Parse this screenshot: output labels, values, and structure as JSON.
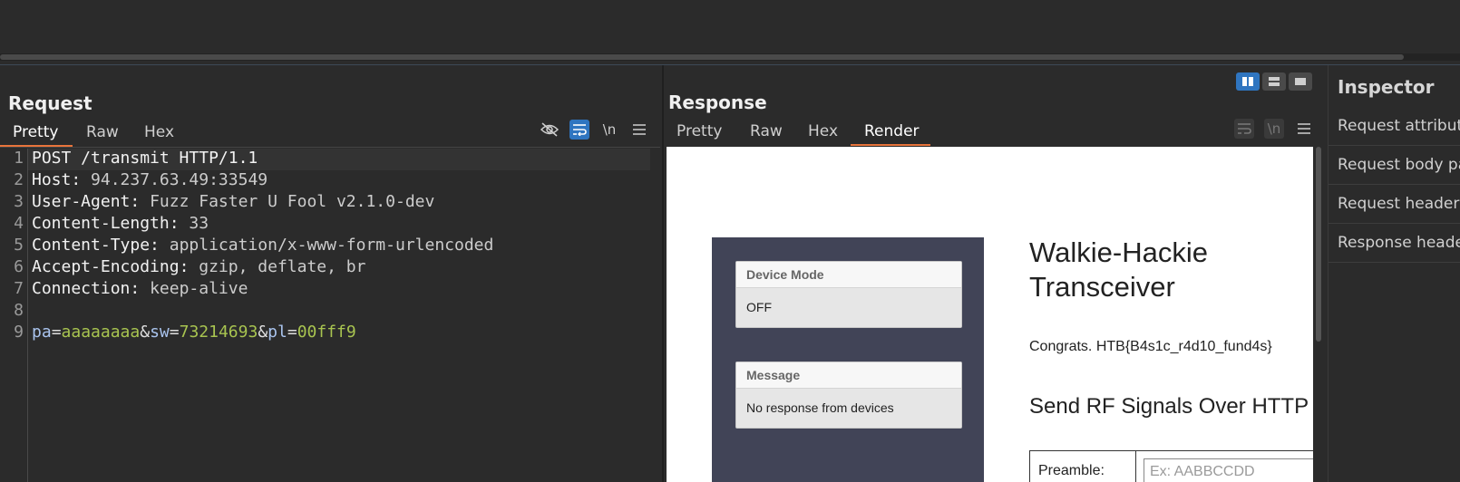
{
  "request": {
    "title": "Request",
    "tabs": [
      "Pretty",
      "Raw",
      "Hex"
    ],
    "active_tab": "Pretty",
    "toolbar": {
      "newline_label": "\\n"
    },
    "lines": [
      {
        "num": "1",
        "method": "POST /transmit HTTP/1.1"
      },
      {
        "num": "2",
        "key": "Host",
        "value": "94.237.63.49:33549"
      },
      {
        "num": "3",
        "key": "User-Agent",
        "value": "Fuzz Faster U Fool v2.1.0-dev"
      },
      {
        "num": "4",
        "key": "Content-Length",
        "value": "33"
      },
      {
        "num": "5",
        "key": "Content-Type",
        "value": "application/x-www-form-urlencoded"
      },
      {
        "num": "6",
        "key": "Accept-Encoding",
        "value": "gzip, deflate, br"
      },
      {
        "num": "7",
        "key": "Connection",
        "value": "keep-alive"
      },
      {
        "num": "8"
      },
      {
        "num": "9",
        "params": [
          {
            "name": "pa",
            "value": "aaaaaaaa"
          },
          {
            "name": "sw",
            "value": "73214693"
          },
          {
            "name": "pl",
            "value": "00fff9"
          }
        ]
      }
    ]
  },
  "response": {
    "title": "Response",
    "tabs": [
      "Pretty",
      "Raw",
      "Hex",
      "Render"
    ],
    "active_tab": "Render",
    "toolbar": {
      "newline_label": "\\n"
    },
    "render": {
      "device_mode_label": "Device Mode",
      "device_mode_value": "OFF",
      "message_label": "Message",
      "message_value": "No response from devices",
      "title_line1": "Walkie-Hackie",
      "title_line2": "Transceiver",
      "flag_text": "Congrats. HTB{B4s1c_r4d10_fund4s}",
      "heading": "Send RF Signals Over HTTP",
      "preamble_label": "Preamble:",
      "preamble_placeholder": "Ex: AABBCCDD"
    }
  },
  "inspector": {
    "title": "Inspector",
    "items": [
      "Request attributes",
      "Request body parameters",
      "Request headers",
      "Response headers"
    ]
  },
  "colors": {
    "accent_tab": "#e8743b",
    "toggle_on": "#2f75c0",
    "param_name": "#aac4ee",
    "param_value": "#a8c450"
  }
}
